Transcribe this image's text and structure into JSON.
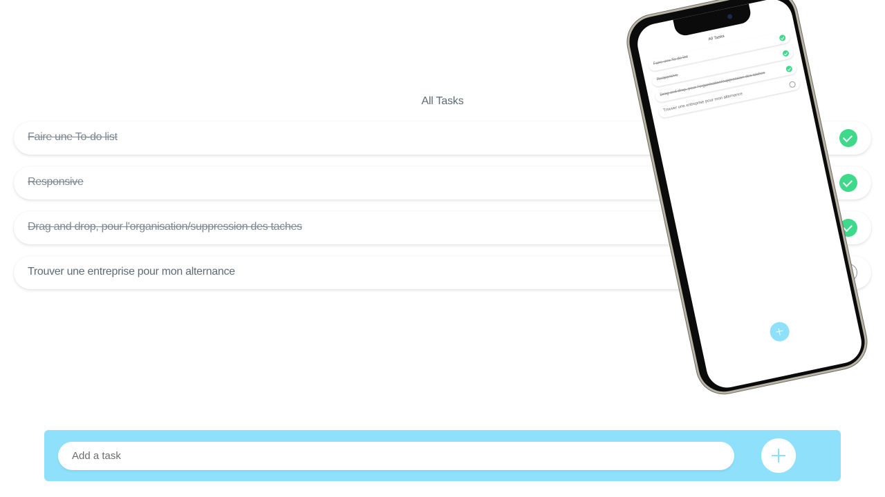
{
  "app": {
    "title": "All Tasks"
  },
  "tasks": [
    {
      "label": "Faire une To-do list",
      "done": true
    },
    {
      "label": "Responsive",
      "done": true
    },
    {
      "label": "Drag and drop, pour l'organisation/suppression des taches",
      "done": true
    },
    {
      "label": "Trouver une entreprise pour mon alternance",
      "done": false
    }
  ],
  "composer": {
    "placeholder": "Add a task",
    "add_icon": "plus-icon"
  },
  "phone_preview": {
    "title": "All Tasks",
    "tasks": [
      {
        "label": "Faire une To-do list",
        "done": true
      },
      {
        "label": "Responsive",
        "done": true
      },
      {
        "label": "Drag and drop, pour l'organisation/suppression des taches",
        "done": true
      },
      {
        "label": "Trouver une entreprise pour mon alternance",
        "done": false
      }
    ]
  },
  "colors": {
    "accent": "#8fe1fb",
    "done": "#3ed98a",
    "text": "#5e6a74"
  }
}
